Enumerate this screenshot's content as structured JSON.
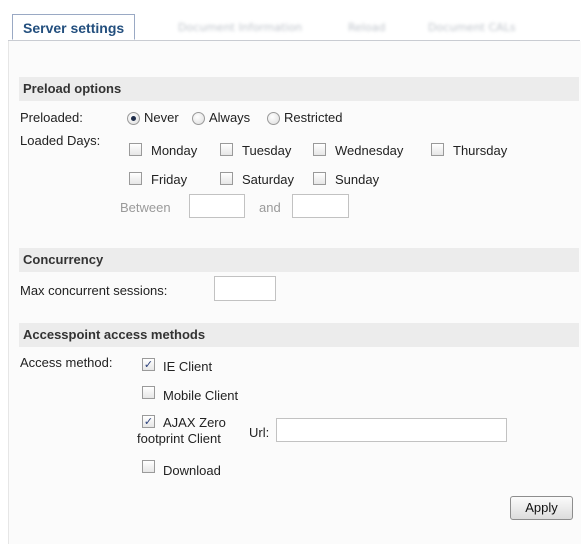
{
  "tabs": [
    {
      "label": "Server settings"
    },
    {
      "label": "Document Information"
    },
    {
      "label": "Reload"
    },
    {
      "label": "Document CALs"
    }
  ],
  "preload": {
    "header": "Preload options",
    "preloaded_label": "Preloaded:",
    "options": [
      "Never",
      "Always",
      "Restricted"
    ],
    "selected": "Never",
    "loaded_days_label": "Loaded Days:",
    "days": [
      "Monday",
      "Tuesday",
      "Wednesday",
      "Thursday",
      "Friday",
      "Saturday",
      "Sunday"
    ],
    "between_label": "Between",
    "and_label": "and",
    "between_from": "",
    "between_to": ""
  },
  "concurrency": {
    "header": "Concurrency",
    "max_label": "Max concurrent sessions:",
    "max_value": ""
  },
  "access": {
    "header": "Accesspoint access methods",
    "method_label": "Access method:",
    "methods": [
      {
        "label": "IE Client",
        "checked": true
      },
      {
        "label": "Mobile Client",
        "checked": false
      },
      {
        "label_line1": "AJAX Zero",
        "label_line2": "footprint Client",
        "checked": true
      },
      {
        "label": "Download",
        "checked": false
      }
    ],
    "url_label": "Url:",
    "url_value": ""
  },
  "apply_label": "Apply"
}
